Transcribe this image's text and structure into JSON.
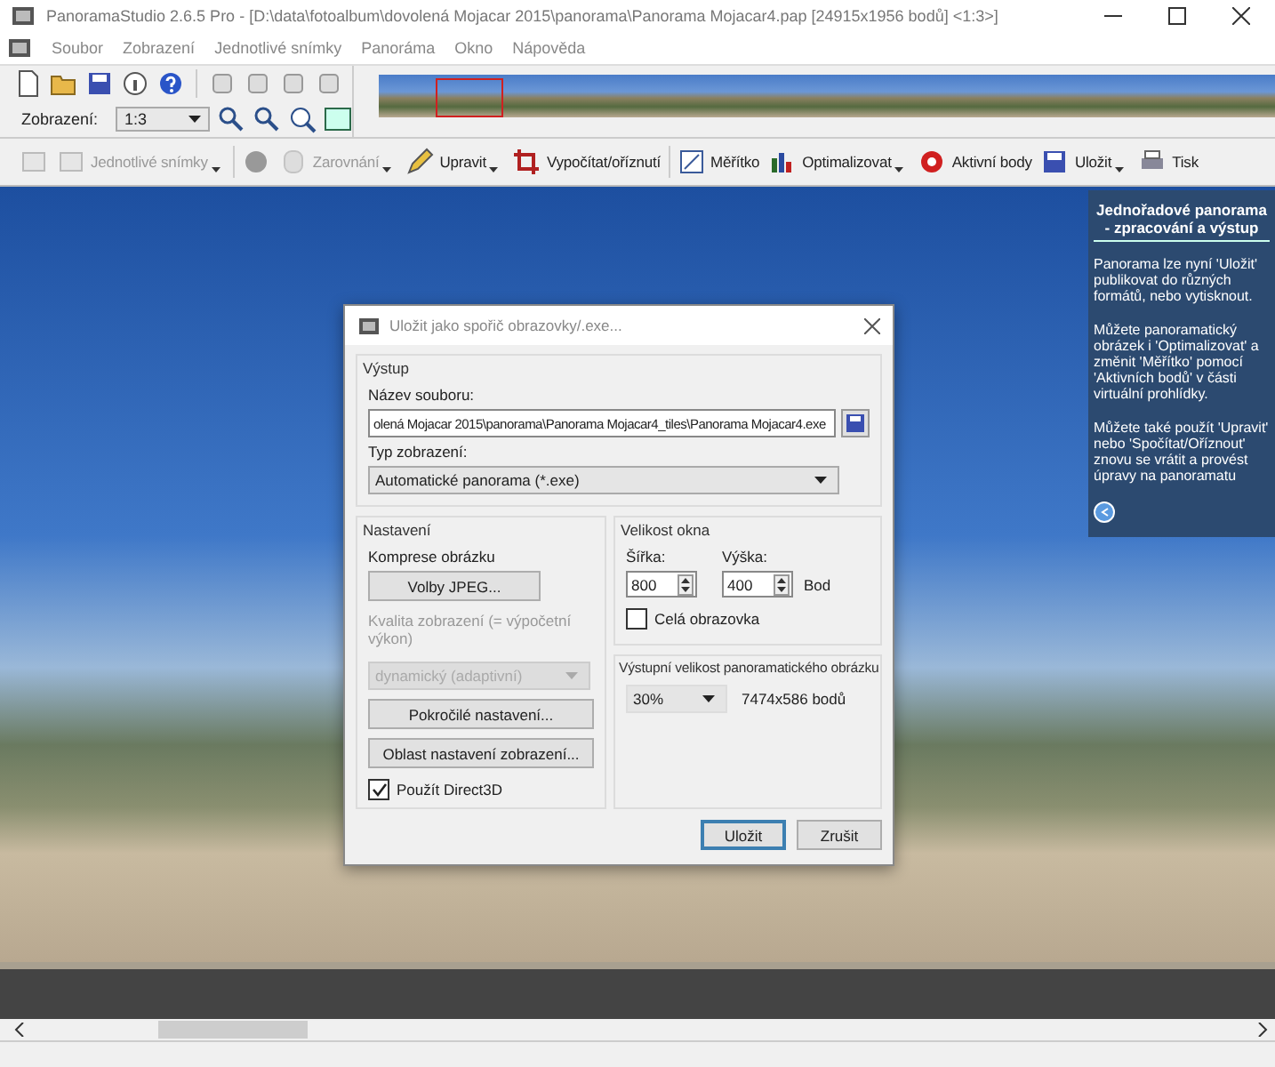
{
  "window": {
    "title": "PanoramaStudio 2.6.5 Pro - [D:\\data\\fotoalbum\\dovolená Mojacar 2015\\panorama\\Panorama Mojacar4.pap [24915x1956 bodů] <1:3>]"
  },
  "menu": [
    {
      "label": "Soubor"
    },
    {
      "label": "Zobrazení"
    },
    {
      "label": "Jednotlivé snímky"
    },
    {
      "label": "Panoráma"
    },
    {
      "label": "Okno"
    },
    {
      "label": "Nápověda"
    }
  ],
  "zoom": {
    "label": "Zobrazení:",
    "value": "1:3"
  },
  "action_toolbar": [
    {
      "disabled": true,
      "dropdown": false
    },
    {
      "label": "Jednotlivé snímky",
      "disabled": true,
      "dropdown": true
    },
    {
      "disabled": false,
      "dropdown": false
    },
    {
      "label": "Zarovnání",
      "disabled": true,
      "dropdown": true
    },
    {
      "label": "Upravit",
      "disabled": false,
      "dropdown": true
    },
    {
      "label": "Vypočítat/oříznutí",
      "disabled": false,
      "dropdown": false
    },
    {
      "label": "Měřítko",
      "disabled": false,
      "dropdown": false
    },
    {
      "label": "Optimalizovat",
      "disabled": false,
      "dropdown": true
    },
    {
      "label": "Aktivní body",
      "disabled": false,
      "dropdown": false
    },
    {
      "label": "Uložit",
      "disabled": false,
      "dropdown": true
    },
    {
      "label": "Tisk",
      "disabled": false,
      "dropdown": false
    }
  ],
  "help_panel": {
    "title": "Jednořadové panorama - zpracování a výstup",
    "paragraphs": [
      "Panorama lze nyní 'Uložit' publikovat do různých formátů, nebo vytisknout.",
      "Můžete panoramatický obrázek i 'Optimalizovat' a změnit 'Měřítko' pomocí 'Aktivních bodů' v části virtuální prohlídky.",
      "Můžete také použít 'Upravit' nebo 'Spočítat/Oříznout' znovu se vrátit a provést úpravy na panoramatu"
    ]
  },
  "dialog": {
    "title": "Uložit jako spořič obrazovky/.exe...",
    "output": {
      "legend": "Výstup",
      "file_label": "Název souboru:",
      "file_value": "olená Mojacar 2015\\panorama\\Panorama Mojacar4_tiles\\Panorama Mojacar4.exe",
      "type_label": "Typ zobrazení:",
      "type_value": "Automatické panorama (*.exe)"
    },
    "settings": {
      "legend": "Nastavení",
      "compression_label": "Komprese obrázku",
      "jpeg_button": "Volby JPEG...",
      "quality_label": "Kvalita zobrazení (= výpočetní výkon)",
      "quality_disabled": true,
      "quality_value": "dynamický (adaptivní)",
      "advanced_button": "Pokročilé nastavení...",
      "area_button": "Oblast nastavení zobrazení...",
      "direct3d": {
        "label": "Použít Direct3D",
        "checked": true
      }
    },
    "window_size": {
      "legend": "Velikost okna",
      "width_label": "Šířka:",
      "width_value": "800",
      "height_label": "Výška:",
      "height_value": "400",
      "unit": "Bod",
      "fullscreen": {
        "label": "Celá obrazovka",
        "checked": false
      }
    },
    "output_size": {
      "legend": "Výstupní velikost panoramatického obrázku",
      "value": "30%",
      "result": "7474x586 bodů"
    },
    "buttons": [
      {
        "label": "Uložit",
        "default": true
      },
      {
        "label": "Zrušit",
        "default": false
      }
    ]
  }
}
